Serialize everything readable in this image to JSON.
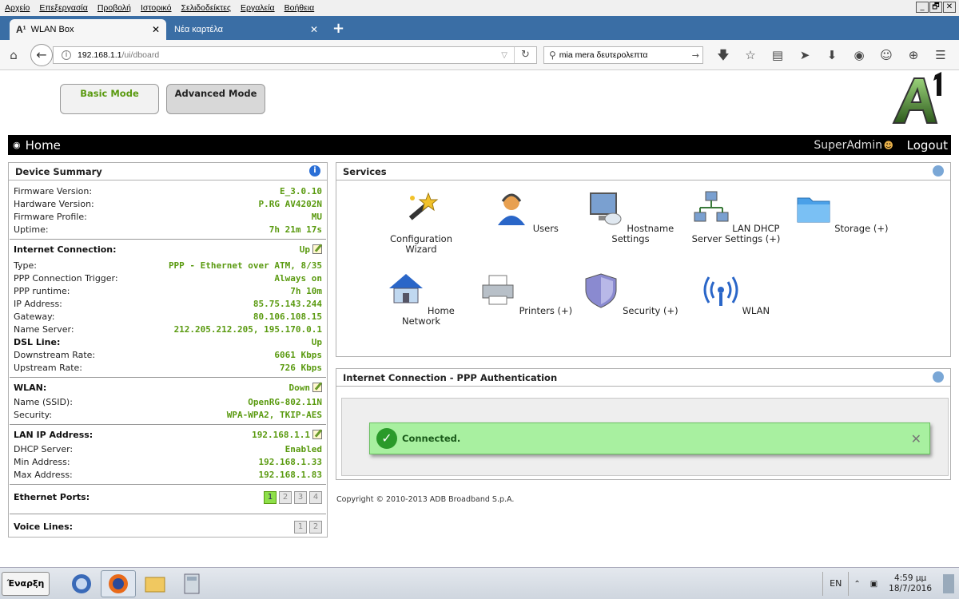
{
  "browser": {
    "menu": [
      "Αρχείο",
      "Επεξεργασία",
      "Προβολή",
      "Ιστορικό",
      "Σελιδοδείκτες",
      "Εργαλεία",
      "Βοήθεια"
    ],
    "window_controls": [
      "_",
      "🗗",
      "✕"
    ],
    "tabs": [
      {
        "logo": "A¹",
        "title": "WLAN Box",
        "close": "✕"
      },
      {
        "title": "Νέα καρτέλα",
        "close": "✕"
      }
    ],
    "new_tab": "+",
    "url_host": "192.168.1.1",
    "url_path": "/ui/dboard",
    "search_value": "mia mera δευτερολεπτα"
  },
  "header": {
    "basic_mode": "Basic Mode",
    "advanced_mode": "Advanced Mode",
    "home_title": "Home",
    "user": "SuperAdmin",
    "logout": "Logout"
  },
  "device_summary": {
    "title": "Device Summary",
    "info_glyph": "i",
    "firmware_version": {
      "label": "Firmware Version:",
      "value": "E_3.0.10"
    },
    "hardware_version": {
      "label": "Hardware Version:",
      "value": "P.RG AV4202N"
    },
    "firmware_profile": {
      "label": "Firmware Profile:",
      "value": "MU"
    },
    "uptime": {
      "label": "Uptime:",
      "value": "7h 21m 17s"
    },
    "internet": {
      "label": "Internet Connection:",
      "value": "Up"
    },
    "type": {
      "label": "Type:",
      "value": "PPP - Ethernet over ATM, 8/35"
    },
    "ppp_trigger": {
      "label": "PPP Connection Trigger:",
      "value": "Always on"
    },
    "ppp_runtime": {
      "label": "PPP runtime:",
      "value": "7h 10m"
    },
    "ip_address": {
      "label": "IP Address:",
      "value": "85.75.143.244"
    },
    "gateway": {
      "label": "Gateway:",
      "value": "80.106.108.15"
    },
    "name_server": {
      "label": "Name Server:",
      "value": "212.205.212.205, 195.170.0.1"
    },
    "dsl_line": {
      "label": "DSL Line:",
      "value": "Up"
    },
    "downstream": {
      "label": "Downstream Rate:",
      "value": "6061 Kbps"
    },
    "upstream": {
      "label": "Upstream Rate:",
      "value": "726 Kbps"
    },
    "wlan": {
      "label": "WLAN:",
      "value": "Down"
    },
    "ssid": {
      "label": "Name (SSID):",
      "value": "OpenRG-802.11N"
    },
    "security": {
      "label": "Security:",
      "value": "WPA-WPA2, TKIP-AES"
    },
    "lan_ip": {
      "label": "LAN IP Address:",
      "value": "192.168.1.1"
    },
    "dhcp": {
      "label": "DHCP Server:",
      "value": "Enabled"
    },
    "min_addr": {
      "label": "Min Address:",
      "value": "192.168.1.33"
    },
    "max_addr": {
      "label": "Max Address:",
      "value": "192.168.1.83"
    },
    "ethernet_ports": {
      "label": "Ethernet Ports:",
      "ports": [
        "1",
        "2",
        "3",
        "4"
      ],
      "active": "1"
    },
    "voice_lines": {
      "label": "Voice Lines:",
      "lines": [
        "1",
        "2"
      ]
    }
  },
  "services": {
    "title": "Services",
    "items": [
      {
        "label": "Configuration Wizard",
        "icon": "wizard-icon"
      },
      {
        "label": "Users",
        "icon": "user-icon"
      },
      {
        "label": "Hostname Settings",
        "icon": "monitor-icon"
      },
      {
        "label": "LAN DHCP Server Settings (+)",
        "icon": "network-icon"
      },
      {
        "label": "Storage (+)",
        "icon": "folder-icon"
      },
      {
        "label": "Home Network",
        "icon": "home-network-icon"
      },
      {
        "label": "Printers (+)",
        "icon": "printer-icon"
      },
      {
        "label": "Security (+)",
        "icon": "shield-icon"
      },
      {
        "label": "WLAN",
        "icon": "wifi-icon"
      }
    ]
  },
  "ppp": {
    "title": "Internet Connection - PPP Authentication",
    "status": "Connected.",
    "ok_glyph": "✓",
    "dismiss_glyph": "✕"
  },
  "footer": {
    "copyright": "Copyright © 2010-2013 ADB Broadband S.p.A."
  },
  "taskbar": {
    "start": "Έναρξη",
    "lang": "EN",
    "time": "4:59 μμ",
    "date": "18/7/2016"
  },
  "colors": {
    "accent_green": "#5a9a10",
    "tab_bar": "#3a6ea5",
    "connected_bg": "#a8f0a0"
  }
}
